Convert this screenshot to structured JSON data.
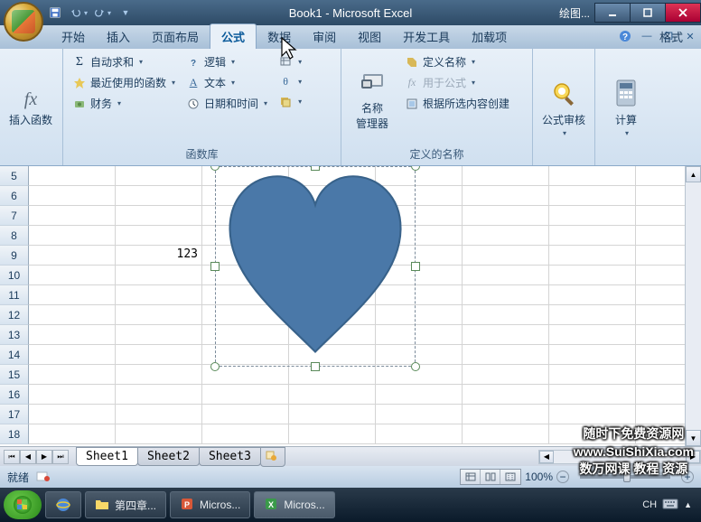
{
  "titlebar": {
    "title": "Book1 - Microsoft Excel",
    "context_title": "绘图..."
  },
  "tabs": {
    "items": [
      "开始",
      "插入",
      "页面布局",
      "公式",
      "数据",
      "审阅",
      "视图",
      "开发工具",
      "加载项"
    ],
    "active_index": 3,
    "context_tab": "格式",
    "help": "?"
  },
  "ribbon": {
    "insert_fn": {
      "label": "插入函数",
      "icon": "fx"
    },
    "lib": {
      "autosum": "自动求和",
      "recent": "最近使用的函数",
      "financial": "财务",
      "logic": "逻辑",
      "text": "文本",
      "datetime": "日期和时间",
      "label": "函数库"
    },
    "names": {
      "manager": "名称\n管理器",
      "define": "定义名称",
      "use": "用于公式",
      "create": "根据所选内容创建",
      "label": "定义的名称"
    },
    "audit": {
      "label": "公式审核"
    },
    "calc": {
      "label": "计算"
    }
  },
  "sheet": {
    "rows": [
      "5",
      "6",
      "7",
      "8",
      "9",
      "10",
      "11",
      "12",
      "13",
      "14",
      "15",
      "16",
      "17",
      "18"
    ],
    "cell_value": "123"
  },
  "shape": {
    "type": "heart",
    "fill": "#4a78a8",
    "stroke": "#38628a"
  },
  "sheet_tabs": {
    "sheets": [
      "Sheet1",
      "Sheet2",
      "Sheet3"
    ],
    "active_index": 0
  },
  "statusbar": {
    "ready": "就绪",
    "zoom": "100%"
  },
  "watermark": {
    "line1": "随时下免费资源网",
    "line2": "www.SuiShiXia.com",
    "line3": "数万网课 教程 资源"
  },
  "taskbar": {
    "items": [
      {
        "label": "第四章...",
        "icon": "folder"
      },
      {
        "label": "Micros...",
        "icon": "ppt"
      },
      {
        "label": "Micros...",
        "icon": "excel"
      }
    ],
    "ime": "CH",
    "tray_icon": "keyboard"
  }
}
